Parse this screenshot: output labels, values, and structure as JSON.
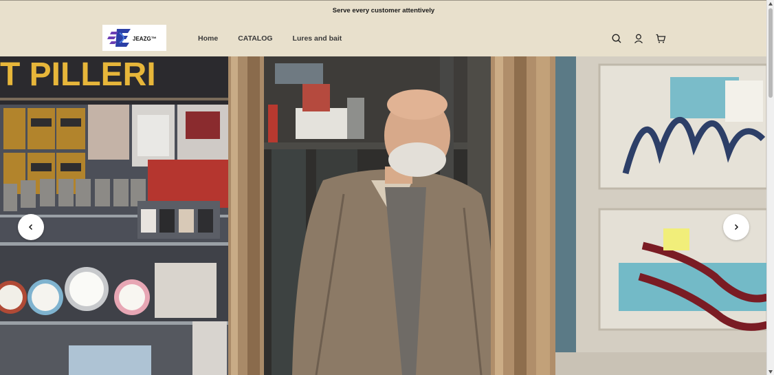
{
  "announcement": {
    "text": "Serve every customer attentively"
  },
  "logo": {
    "text": "JEAZG™"
  },
  "nav": {
    "items": [
      {
        "label": "Home"
      },
      {
        "label": "CATALOG"
      },
      {
        "label": "Lures and bait"
      }
    ]
  },
  "header_icons": [
    "search-icon",
    "account-icon",
    "cart-icon"
  ],
  "hero": {
    "prev_icon": "chevron-left-icon",
    "next_icon": "chevron-right-icon",
    "sign_text": "T PILLERI"
  },
  "colors": {
    "header_bg": "#e8e0cc",
    "logo_blue": "#2b3fa6",
    "logo_purple": "#6b3fb5"
  }
}
